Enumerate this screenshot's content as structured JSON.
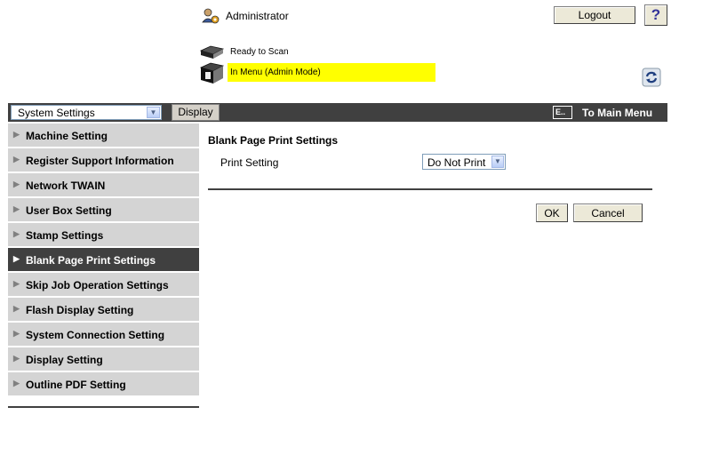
{
  "header": {
    "user_label": "Administrator",
    "logout_label": "Logout",
    "help_label": "?",
    "scanner_status": "Ready to Scan",
    "mode_status": "In Menu (Admin Mode)",
    "status_highlight_color": "#ffff00"
  },
  "menubar": {
    "select_value": "System Settings",
    "display_label": "Display",
    "main_menu_label": "To Main Menu",
    "bar_color": "#404040"
  },
  "sidebar": {
    "items": [
      {
        "label": "Machine Setting"
      },
      {
        "label": "Register Support Information"
      },
      {
        "label": "Network TWAIN"
      },
      {
        "label": "User Box Setting"
      },
      {
        "label": "Stamp Settings"
      },
      {
        "label": "Blank Page Print Settings",
        "active": true
      },
      {
        "label": "Skip Job Operation Settings"
      },
      {
        "label": "Flash Display Setting"
      },
      {
        "label": "System Connection Setting"
      },
      {
        "label": "Display Setting"
      },
      {
        "label": "Outline PDF Setting"
      }
    ]
  },
  "main": {
    "title": "Blank Page Print Settings",
    "print_setting_label": "Print Setting",
    "print_setting_value": "Do Not Print",
    "ok_label": "OK",
    "cancel_label": "Cancel"
  },
  "icons": [
    "admin-user-icon",
    "scanner-icon",
    "scanner-menu-icon",
    "refresh-icon",
    "main-menu-icon",
    "chevron-down-icon",
    "triangle-right-icon"
  ]
}
